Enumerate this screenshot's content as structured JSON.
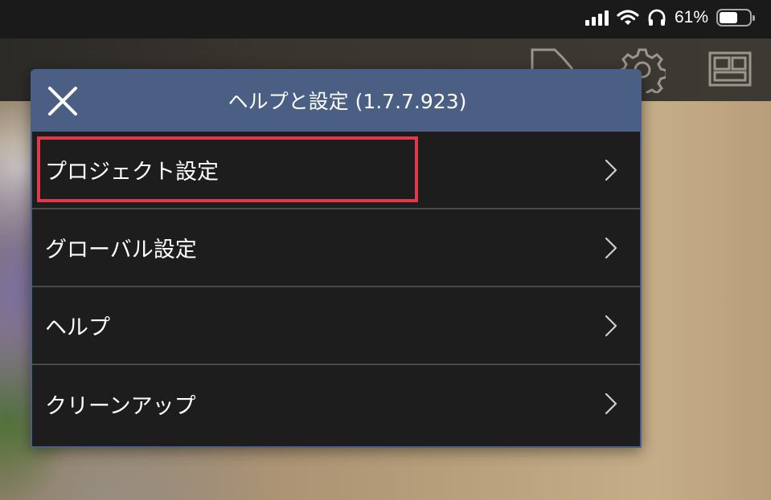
{
  "status_bar": {
    "battery_percent": "61%",
    "battery_level": 0.61,
    "icons": [
      "cellular-signal-icon",
      "wifi-icon",
      "headphones-icon",
      "battery-icon"
    ]
  },
  "toolbar": {
    "icons": [
      "export-icon",
      "settings-gear-icon",
      "layout-icon"
    ]
  },
  "dialog": {
    "title": "ヘルプと設定 (1.7.7.923)",
    "close_icon": "close-icon",
    "items": [
      {
        "label": "プロジェクト設定",
        "icon": "chevron-right-icon",
        "highlighted": true
      },
      {
        "label": "グローバル設定",
        "icon": "chevron-right-icon"
      },
      {
        "label": "ヘルプ",
        "icon": "chevron-right-icon"
      },
      {
        "label": "クリーンアップ",
        "icon": "chevron-right-icon"
      }
    ]
  },
  "colors": {
    "header": "#4a5f83",
    "panel": "#1d1d1d",
    "divider": "#4b4b4b",
    "highlight": "#e0394a",
    "text": "#ffffff"
  }
}
